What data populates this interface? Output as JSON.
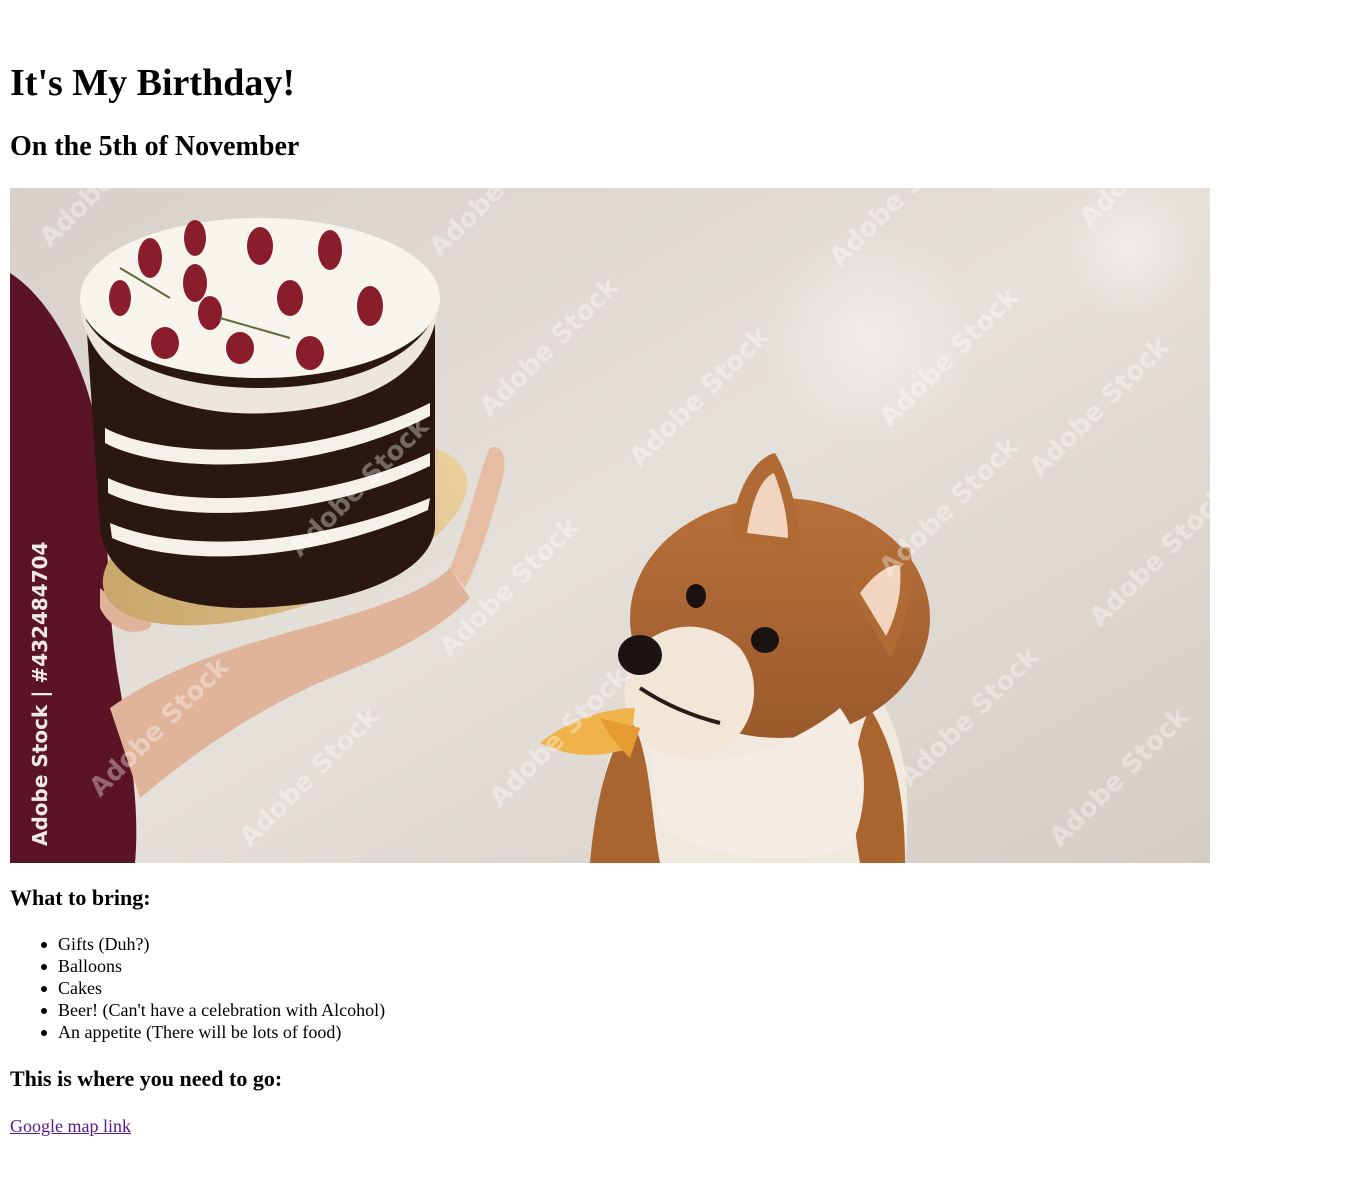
{
  "header": {
    "title": "It's My Birthday!",
    "subtitle": "On the 5th of November"
  },
  "hero_image": {
    "watermark_side": "Adobe Stock | #432484704",
    "watermark_tile": "Adobe Stock"
  },
  "bring_section": {
    "heading": "What to bring:",
    "items": [
      "Gifts (Duh?)",
      "Balloons",
      "Cakes",
      "Beer! (Can't have a celebration with Alcohol)",
      "An appetite (There will be lots of food)"
    ]
  },
  "location_section": {
    "heading": "This is where you need to go:",
    "link_text": "Google map link"
  },
  "colors": {
    "link_visited": "#551a8b",
    "text": "#000000",
    "background": "#ffffff"
  }
}
